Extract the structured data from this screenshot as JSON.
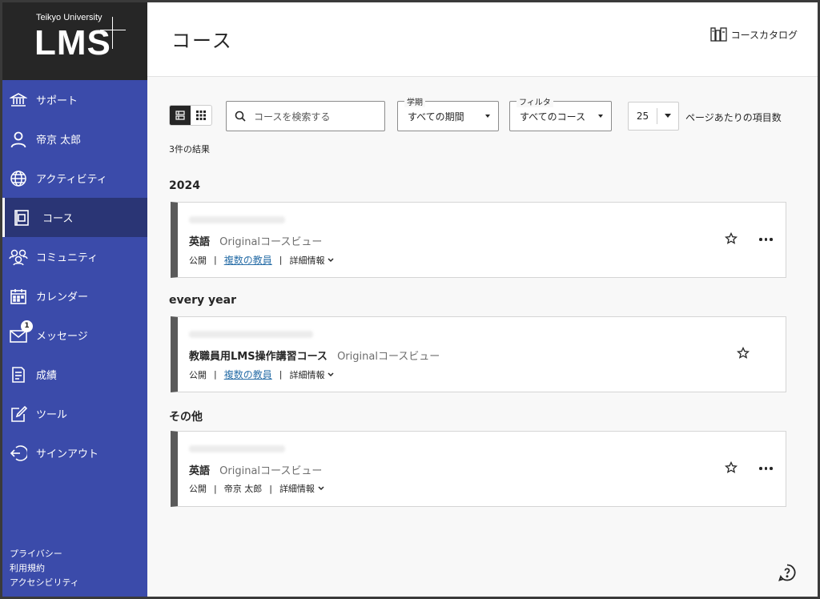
{
  "sidebar": {
    "logo": {
      "university": "Teikyo University",
      "product": "LMS"
    },
    "items": [
      {
        "label": "サポート",
        "icon": "institution-icon"
      },
      {
        "label": "帝京 太郎",
        "icon": "user-icon"
      },
      {
        "label": "アクティビティ",
        "icon": "globe-icon"
      },
      {
        "label": "コース",
        "icon": "course-icon"
      },
      {
        "label": "コミュニティ",
        "icon": "community-icon"
      },
      {
        "label": "カレンダー",
        "icon": "calendar-icon"
      },
      {
        "label": "メッセージ",
        "icon": "mail-icon",
        "badge": "1"
      },
      {
        "label": "成績",
        "icon": "grades-icon"
      },
      {
        "label": "ツール",
        "icon": "tools-icon"
      },
      {
        "label": "サインアウト",
        "icon": "signout-icon"
      }
    ],
    "active_index": 3,
    "footer": {
      "privacy": "プライバシー",
      "terms": "利用規約",
      "accessibility": "アクセシビリティ"
    }
  },
  "header": {
    "title": "コース",
    "catalog_label": "コースカタログ"
  },
  "toolbar": {
    "search_placeholder": "コースを検索する",
    "term": {
      "legend": "学期",
      "value": "すべての期間"
    },
    "filter": {
      "legend": "フィルタ",
      "value": "すべてのコース"
    },
    "per_page": {
      "value": "25",
      "label": "ページあたりの項目数"
    }
  },
  "results": "3件の結果",
  "groups": [
    {
      "title": "2024",
      "course": {
        "name": "英語",
        "view": "Originalコースビュー",
        "status": "公開",
        "instructor": "複数の教員",
        "instructor_is_link": true,
        "details": "詳細情報"
      }
    },
    {
      "title": "every year",
      "course": {
        "name": "教職員用LMS操作講習コース",
        "view": "Originalコースビュー",
        "status": "公開",
        "instructor": "複数の教員",
        "instructor_is_link": true,
        "details": "詳細情報"
      }
    },
    {
      "title": "その他",
      "course": {
        "name": "英語",
        "view": "Originalコースビュー",
        "status": "公開",
        "instructor": "帝京 太郎",
        "instructor_is_link": false,
        "details": "詳細情報"
      }
    }
  ],
  "colors": {
    "sidebar": "#3b4baa",
    "sidebar_active": "#2a3575",
    "link": "#2a6fa8",
    "card_accent": "#5a5a5a"
  }
}
